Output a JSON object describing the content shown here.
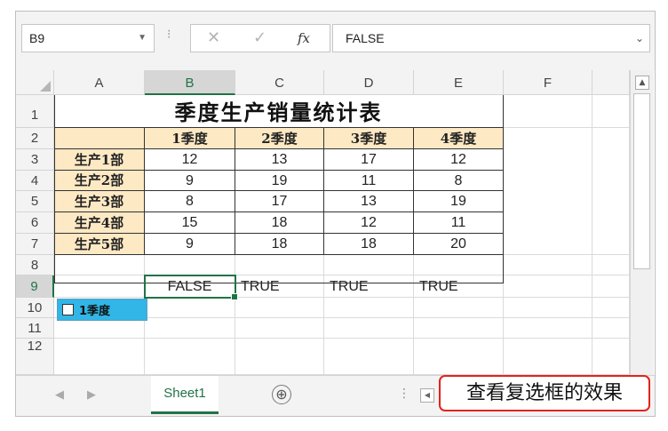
{
  "formula_bar": {
    "name_box": "B9",
    "cancel_icon": "✕",
    "enter_icon": "✓",
    "fx_icon": "fx",
    "content": "FALSE"
  },
  "columns": [
    "A",
    "B",
    "C",
    "D",
    "E",
    "F"
  ],
  "rows": [
    "1",
    "2",
    "3",
    "4",
    "5",
    "6",
    "7",
    "8",
    "9",
    "10",
    "11",
    "12"
  ],
  "sheet": {
    "title": "季度生产销量统计表",
    "header_row": [
      "",
      "1季度",
      "2季度",
      "3季度",
      "4季度"
    ],
    "data_rows": [
      {
        "label": "生产1部",
        "values": [
          "12",
          "13",
          "17",
          "12"
        ]
      },
      {
        "label": "生产2部",
        "values": [
          "9",
          "19",
          "11",
          "8"
        ]
      },
      {
        "label": "生产3部",
        "values": [
          "8",
          "17",
          "13",
          "19"
        ]
      },
      {
        "label": "生产4部",
        "values": [
          "15",
          "18",
          "12",
          "11"
        ]
      },
      {
        "label": "生产5部",
        "values": [
          "9",
          "18",
          "18",
          "20"
        ]
      }
    ],
    "row9": [
      "FALSE",
      "TRUE",
      "TRUE",
      "TRUE"
    ],
    "checkbox_label": "1季度",
    "checkbox_checked": false
  },
  "tabs": {
    "active_sheet": "Sheet1",
    "add_icon": "⊕"
  },
  "callout": "查看复选框的效果",
  "colors": {
    "header_fill": "#fde9c4",
    "accent_green": "#217346",
    "checkbox_cell": "#31b6e7",
    "callout_border": "#e2231a"
  }
}
